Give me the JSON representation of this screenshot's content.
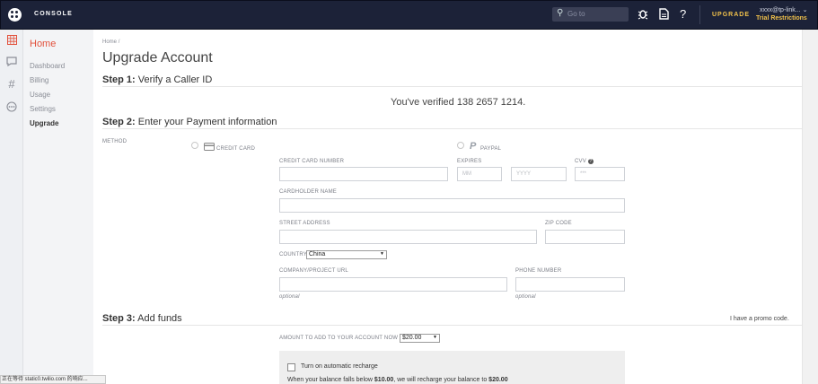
{
  "topbar": {
    "brand": "CONSOLE",
    "search_placeholder": "Go to",
    "upgrade_label": "UPGRADE",
    "account_label": "xxxx@tp-link...",
    "trial_label": "Trial Restrictions",
    "icons": [
      "logo-icon",
      "search-icon",
      "bug-icon",
      "document-icon",
      "help-icon",
      "chevron-down-icon"
    ]
  },
  "rail": {
    "icons": [
      "dashboard-grid-icon",
      "chat-icon",
      "hash-icon",
      "more-icon"
    ]
  },
  "nav": {
    "home": "Home",
    "items": [
      "Dashboard",
      "Billing",
      "Usage",
      "Settings",
      "Upgrade"
    ]
  },
  "page": {
    "breadcrumb": "Home",
    "breadcrumb_sep": "/",
    "title": "Upgrade Account",
    "step1_prefix": "Step 1:",
    "step1_text": "Verify a Caller ID",
    "verified": "You've verified 138 2657 1214.",
    "step2_prefix": "Step 2:",
    "step2_text": "Enter your Payment information",
    "method_label": "METHOD",
    "credit_card": "CREDIT CARD",
    "paypal": "PAYPAL",
    "card_number_label": "CREDIT CARD NUMBER",
    "expires_label": "EXPIRES",
    "mm_placeholder": "MM",
    "yyyy_placeholder": "YYYY",
    "cvv_label": "CVV",
    "cvv_placeholder": "***",
    "cardholder_label": "CARDHOLDER NAME",
    "street_label": "STREET ADDRESS",
    "zip_label": "ZIP CODE",
    "country_label": "COUNTRY",
    "country_value": "China",
    "company_label": "COMPANY/PROJECT URL",
    "phone_label": "PHONE NUMBER",
    "optional": "optional",
    "step3_prefix": "Step 3:",
    "step3_text": "Add funds",
    "promo": "I have a promo code.",
    "amount_label": "AMOUNT TO ADD TO YOUR ACCOUNT NOW",
    "amount_value": "$20.00",
    "auto_recharge": "Turn on automatic recharge",
    "recharge_pre": "When your balance falls below",
    "recharge_low": "$10.00",
    "recharge_mid": ", we will recharge your balance to",
    "recharge_to": "$20.00"
  },
  "statusbar": "正在等待 static0.twilio.com 的响应...",
  "colors": {
    "topbar": "#1c2238",
    "accent": "#e2523d",
    "gold": "#f2c24b"
  }
}
